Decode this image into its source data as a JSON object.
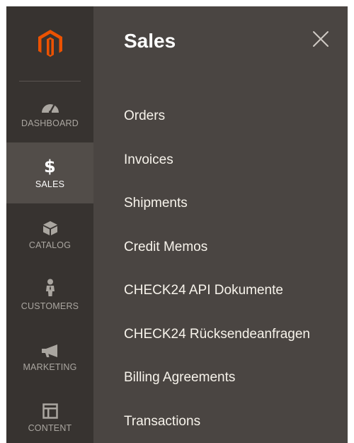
{
  "sidebar": {
    "items": [
      {
        "label": "DASHBOARD",
        "icon": "dashboard-icon"
      },
      {
        "label": "$",
        "sublabel": "SALES",
        "icon": "dollar-icon"
      },
      {
        "label": "CATALOG",
        "icon": "box-icon"
      },
      {
        "label": "CUSTOMERS",
        "icon": "person-icon"
      },
      {
        "label": "MARKETING",
        "icon": "megaphone-icon"
      },
      {
        "label": "CONTENT",
        "icon": "layout-icon"
      }
    ],
    "active": "SALES",
    "logo": "magento-logo-icon"
  },
  "panel": {
    "title": "Sales",
    "close_icon": "close-icon",
    "menu": [
      "Orders",
      "Invoices",
      "Shipments",
      "Credit Memos",
      "CHECK24 API Dokumente",
      "CHECK24 Rücksendeanfragen",
      "Billing Agreements",
      "Transactions"
    ]
  },
  "colors": {
    "sidebar_bg": "#373330",
    "active_bg": "#524d49",
    "panel_bg": "#4a4542",
    "logo_orange": "#eb5202"
  }
}
